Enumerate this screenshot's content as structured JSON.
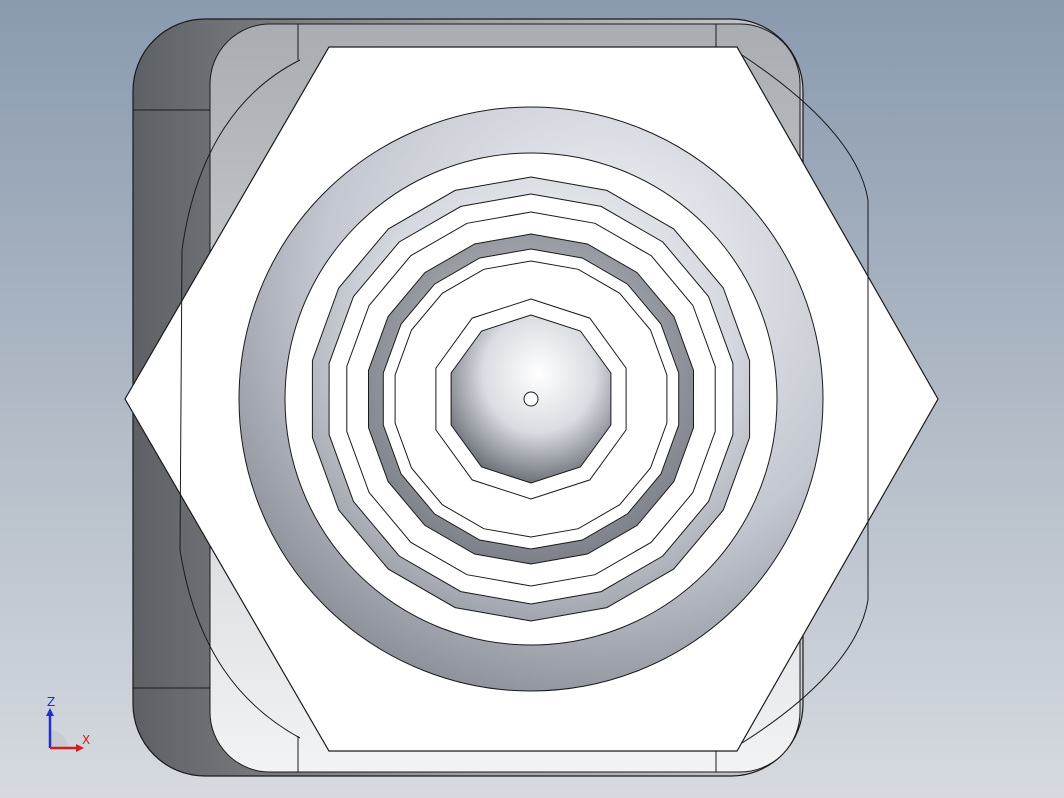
{
  "viewport": {
    "background_top": "#8a9aaf",
    "background_bottom": "#d6dae0"
  },
  "model": {
    "description_icon": "hex-fitting-top-view-icon",
    "body_color": "#ffffff",
    "edge_color": "#1a1a1a",
    "shade_color": "#9aa0a6"
  },
  "triad": {
    "z_label": "Z",
    "x_label": "X",
    "z_color": "#1c2fd6",
    "x_color": "#d61c1c"
  }
}
